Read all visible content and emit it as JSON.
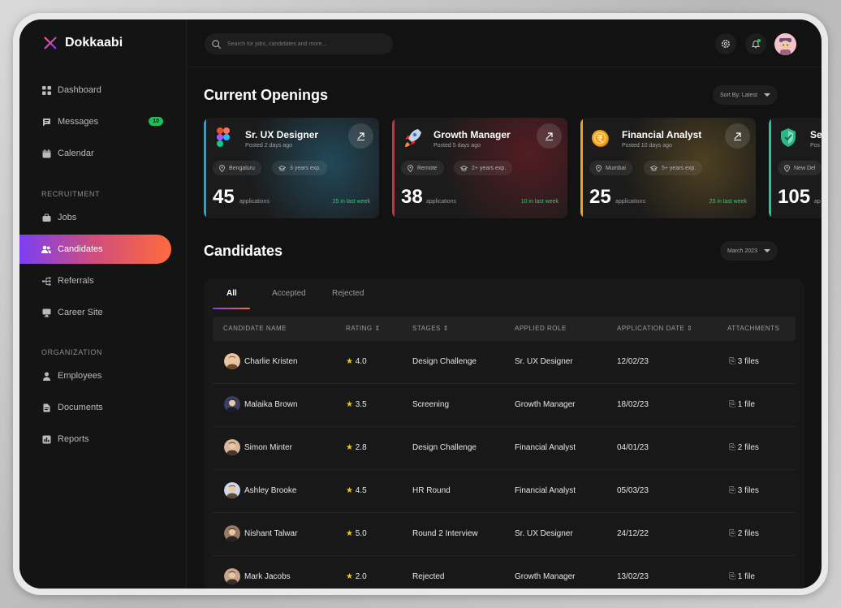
{
  "app": {
    "name": "Dokkaabi"
  },
  "sidebar": {
    "items": [
      {
        "label": "Dashboard"
      },
      {
        "label": "Messages",
        "badge": "10"
      },
      {
        "label": "Calendar"
      }
    ],
    "sections": [
      {
        "title": "RECRUITMENT",
        "items": [
          {
            "label": "Jobs"
          },
          {
            "label": "Candidates",
            "active": true
          },
          {
            "label": "Referrals"
          },
          {
            "label": "Career Site"
          }
        ]
      },
      {
        "title": "ORGANIZATION",
        "items": [
          {
            "label": "Employees"
          },
          {
            "label": "Documents"
          },
          {
            "label": "Reports"
          }
        ]
      }
    ]
  },
  "topbar": {
    "search_placeholder": "Search for jobs, candidates and more..."
  },
  "openings": {
    "title": "Current Openings",
    "sort_label": "Sort By: Latest",
    "cards": [
      {
        "title": "Sr. UX Designer",
        "posted": "Posted 2 days ago",
        "location": "Bengaluru",
        "experience": "3 years exp.",
        "count": "45",
        "count_label": "applications",
        "week": "25 in last week",
        "accent": "#1aa7e0"
      },
      {
        "title": "Growth Manager",
        "posted": "Posted 5 days ago",
        "location": "Remote",
        "experience": "2+ years exp.",
        "count": "38",
        "count_label": "applications",
        "week": "10 in last week",
        "accent": "#e0263a"
      },
      {
        "title": "Financial Analyst",
        "posted": "Posted 10 days ago",
        "location": "Mumbai",
        "experience": "5+ years exp.",
        "count": "25",
        "count_label": "applications",
        "week": "25 in last week",
        "accent": "#f0a31b"
      },
      {
        "title": "Se",
        "posted": "Pos",
        "location": "New Del",
        "experience": "",
        "count": "105",
        "count_label": "ap",
        "week": "",
        "accent": "#1ec7a0"
      }
    ]
  },
  "candidates": {
    "title": "Candidates",
    "month_filter": "March 2023",
    "tabs": [
      "All",
      "Accepted",
      "Rejected"
    ],
    "columns": [
      "CANDIDATE NAME",
      "RATING",
      "STAGES",
      "APPLIED ROLE",
      "APPLICATION DATE",
      "ATTACHMENTS"
    ],
    "rows": [
      {
        "name": "Charlie Kristen",
        "rating": "4.0",
        "stage": "Design Challenge",
        "role": "Sr. UX Designer",
        "date": "12/02/23",
        "files": "3 files"
      },
      {
        "name": "Malaika Brown",
        "rating": "3.5",
        "stage": "Screening",
        "role": "Growth Manager",
        "date": "18/02/23",
        "files": "1 file"
      },
      {
        "name": "Simon Minter",
        "rating": "2.8",
        "stage": "Design Challenge",
        "role": "Financial Analyst",
        "date": "04/01/23",
        "files": "2 files"
      },
      {
        "name": "Ashley Brooke",
        "rating": "4.5",
        "stage": "HR Round",
        "role": "Financial Analyst",
        "date": "05/03/23",
        "files": "3 files"
      },
      {
        "name": "Nishant Talwar",
        "rating": "5.0",
        "stage": "Round 2 Interview",
        "role": "Sr. UX Designer",
        "date": "24/12/22",
        "files": "2 files"
      },
      {
        "name": "Mark Jacobs",
        "rating": "2.0",
        "stage": "Rejected",
        "role": "Growth Manager",
        "date": "13/02/23",
        "files": "1 file"
      }
    ]
  },
  "colors": {
    "background": "#121212",
    "accent_gradient_start": "#7b3ff2",
    "accent_gradient_end": "#ff6a3d",
    "badge_green": "#1bbf5c",
    "star": "#f5c518"
  }
}
